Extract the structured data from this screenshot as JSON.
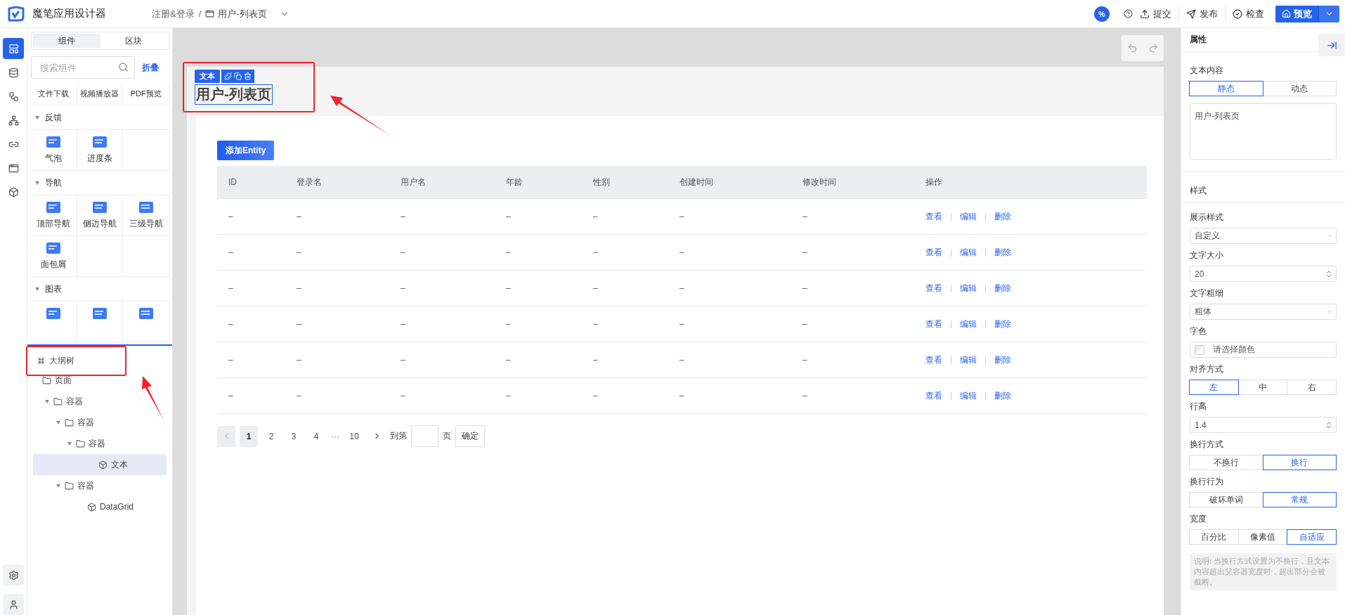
{
  "app": {
    "title": "魔笔应用设计器"
  },
  "breadcrumb": {
    "project": "注册&登录",
    "separator": "/",
    "page": "用户-列表页"
  },
  "toolbar": {
    "badge": "%",
    "actions": [
      {
        "label": "提交",
        "kind": "submit"
      },
      {
        "label": "发布",
        "kind": "publish"
      },
      {
        "label": "检查",
        "kind": "check"
      }
    ],
    "preview": "预览"
  },
  "rail": [
    {
      "selected": true
    },
    {
      "selected": false
    },
    {
      "selected": false
    },
    {
      "selected": false
    },
    {
      "selected": false
    },
    {
      "selected": false
    },
    {
      "selected": false
    }
  ],
  "component_panel": {
    "tabs": [
      {
        "label": "组件",
        "selected": true
      },
      {
        "label": "区块",
        "selected": false
      }
    ],
    "search": {
      "placeholder": "搜索组件"
    },
    "collapse": "折叠",
    "loose_items": [
      "文件下载",
      "视频播放器",
      "PDF预览"
    ],
    "groups": [
      {
        "title": "反馈",
        "expanded": true,
        "items": [
          {
            "kind": "labeled",
            "label": "气泡"
          },
          {
            "kind": "labeled",
            "label": "进度条"
          }
        ]
      },
      {
        "title": "导航",
        "expanded": true,
        "items": [
          {
            "kind": "labeled",
            "label": "顶部导航"
          },
          {
            "kind": "labeled",
            "label": "侧边导航"
          },
          {
            "kind": "labeled",
            "label": "三级导航"
          },
          {
            "kind": "labeled",
            "label": "面包屑"
          }
        ]
      },
      {
        "title": "图表",
        "expanded": true,
        "items": [
          {
            "kind": "icon-only"
          },
          {
            "kind": "icon-only"
          },
          {
            "kind": "icon-only"
          }
        ]
      }
    ]
  },
  "outline": {
    "title": "大纲树",
    "tree": [
      {
        "label": "页面",
        "kind": "folder",
        "selected": false,
        "children": [
          {
            "label": "容器",
            "kind": "folder",
            "expanded": true,
            "selected": false,
            "children": [
              {
                "label": "容器",
                "kind": "folder",
                "expanded": true,
                "selected": false,
                "children": [
                  {
                    "label": "容器",
                    "kind": "folder",
                    "expanded": true,
                    "selected": false,
                    "children": [
                      {
                        "label": "文本",
                        "kind": "component",
                        "selected": true
                      }
                    ]
                  }
                ]
              },
              {
                "label": "容器",
                "kind": "folder",
                "expanded": true,
                "selected": false,
                "children": [
                  {
                    "label": "DataGrid",
                    "kind": "component",
                    "selected": false
                  }
                ]
              }
            ]
          }
        ]
      }
    ]
  },
  "canvas": {
    "selection": {
      "tag": "文本"
    },
    "title": "用户-列表页",
    "add_button": "添加Entity",
    "table": {
      "columns": [
        "ID",
        "登录名",
        "用户名",
        "年龄",
        "性别",
        "创建时间",
        "修改时间",
        "操作"
      ],
      "rows": [
        {
          "cells": [
            "–",
            "–",
            "–",
            "–",
            "–",
            "–",
            "–"
          ],
          "actions": [
            "查看",
            "编辑",
            "删除"
          ]
        },
        {
          "cells": [
            "–",
            "–",
            "–",
            "–",
            "–",
            "–",
            "–"
          ],
          "actions": [
            "查看",
            "编辑",
            "删除"
          ]
        },
        {
          "cells": [
            "–",
            "–",
            "–",
            "–",
            "–",
            "–",
            "–"
          ],
          "actions": [
            "查看",
            "编辑",
            "删除"
          ]
        },
        {
          "cells": [
            "–",
            "–",
            "–",
            "–",
            "–",
            "–",
            "–"
          ],
          "actions": [
            "查看",
            "编辑",
            "删除"
          ]
        },
        {
          "cells": [
            "–",
            "–",
            "–",
            "–",
            "–",
            "–",
            "–"
          ],
          "actions": [
            "查看",
            "编辑",
            "删除"
          ]
        },
        {
          "cells": [
            "–",
            "–",
            "–",
            "–",
            "–",
            "–",
            "–"
          ],
          "actions": [
            "查看",
            "编辑",
            "删除"
          ]
        }
      ]
    },
    "pagination": {
      "pages": [
        {
          "label": "1",
          "kind": "page",
          "selected": true
        },
        {
          "label": "2",
          "kind": "page",
          "selected": false
        },
        {
          "label": "3",
          "kind": "page",
          "selected": false
        },
        {
          "label": "4",
          "kind": "page",
          "selected": false
        },
        {
          "label": "···",
          "kind": "ellipsis"
        },
        {
          "label": "10",
          "kind": "page",
          "selected": false
        }
      ],
      "jump_label": "到第",
      "jump_suffix": "页",
      "confirm": "确定"
    }
  },
  "properties": {
    "title": "属性",
    "content": {
      "label": "文本内容",
      "modes": [
        {
          "label": "静态",
          "selected": true
        },
        {
          "label": "动态",
          "selected": false
        }
      ],
      "value": "用户-列表页"
    },
    "style_title": "样式",
    "fields": [
      {
        "kind": "select",
        "label": "展示样式",
        "value": "自定义"
      },
      {
        "kind": "number",
        "label": "文字大小",
        "value": "20"
      },
      {
        "kind": "select",
        "label": "文字粗细",
        "value": "粗体"
      },
      {
        "kind": "color",
        "label": "字色",
        "placeholder": "请选择颜色"
      },
      {
        "kind": "segmented",
        "label": "对齐方式",
        "options": [
          {
            "label": "左",
            "selected": true
          },
          {
            "label": "中",
            "selected": false
          },
          {
            "label": "右",
            "selected": false
          }
        ]
      },
      {
        "kind": "number",
        "label": "行高",
        "value": "1.4"
      },
      {
        "kind": "segmented",
        "label": "换行方式",
        "options": [
          {
            "label": "不换行",
            "selected": false
          },
          {
            "label": "换行",
            "selected": true
          }
        ]
      },
      {
        "kind": "segmented",
        "label": "换行行为",
        "options": [
          {
            "label": "破坏单词",
            "selected": false
          },
          {
            "label": "常规",
            "selected": true
          }
        ]
      },
      {
        "kind": "segmented",
        "label": "宽度",
        "options": [
          {
            "label": "百分比",
            "selected": false
          },
          {
            "label": "像素值",
            "selected": false
          },
          {
            "label": "自适应",
            "selected": true
          }
        ]
      }
    ],
    "note": "说明: 当换行方式设置为不换行，且文本内容超出父容器宽度时，超出部分会被截断。"
  }
}
